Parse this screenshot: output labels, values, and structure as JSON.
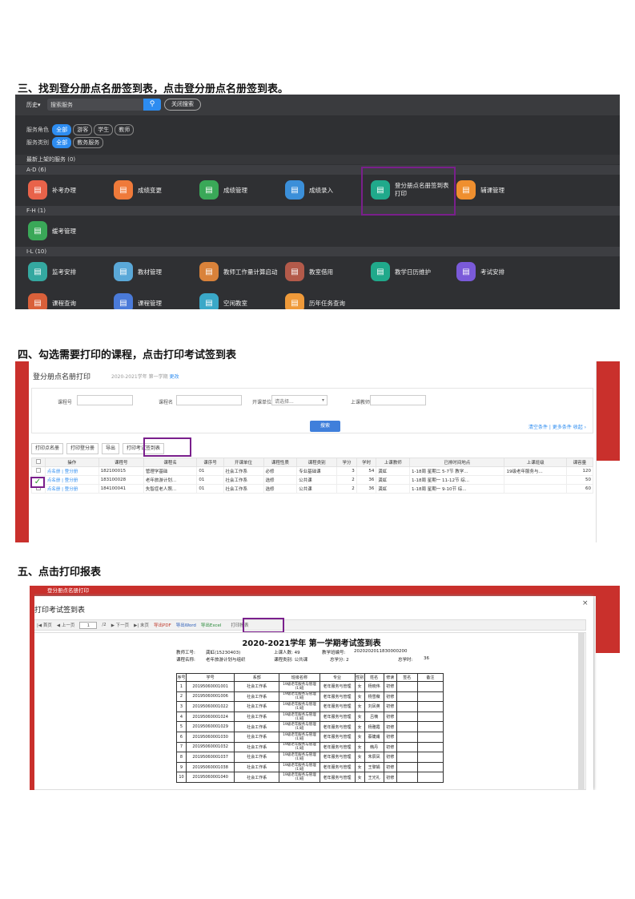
{
  "headings": {
    "h3": "三、找到登分册点名册签到表，点击登分册点名册签到表。",
    "h4": "四、勾选需要打印的课程，点击打印考试签到表",
    "h5": "五、点击打印报表"
  },
  "s3": {
    "history": "历史▾",
    "search_value": "搜索服务",
    "close_search": "关闭搜索",
    "role_label": "服务角色",
    "roles": [
      "全部",
      "游客",
      "学生",
      "教师"
    ],
    "type_label": "服务类别",
    "types": [
      "全部",
      "教务服务"
    ],
    "recent": "最新上架的服务 (0)",
    "group_ad": "A-D (6)",
    "group_fh": "F-H (1)",
    "group_il": "I-L (10)",
    "services_ad": [
      "补考办理",
      "成绩变更",
      "成绩管理",
      "成绩录入",
      "登分册点名册签到表打印",
      "辅课管理"
    ],
    "services_fh": [
      "缓考管理"
    ],
    "services_il": [
      "监考安排",
      "教材管理",
      "教师工作量计算启动",
      "教室借用",
      "教学日历维护",
      "考试安排",
      "课程查询",
      "课程管理",
      "空闲教室",
      "历年任务查询"
    ],
    "colors": {
      "accent": "#2d8cf0",
      "highlight": "#7a1f8c"
    }
  },
  "s4": {
    "title": "登分册点名册打印",
    "subtitle": "2020-2021学年 第一学期",
    "change": "更改",
    "form": {
      "course_no": "课程号",
      "course_name": "课程名",
      "dept": "开课单位",
      "dept_placeholder": "请选择...",
      "teacher": "上课教师",
      "query": "搜索",
      "links": "清空条件 | 更多条件  收起 ›"
    },
    "buttons": [
      "打印点名册",
      "打印登分册",
      "导出",
      "打印考试签到表"
    ],
    "columns": [
      "",
      "操作",
      "课程号",
      "课程名",
      "课序号",
      "开课单位",
      "课程性质",
      "课程类别",
      "学分",
      "学时",
      "上课教师",
      "已排时间地点",
      "上课班级",
      "课容量"
    ],
    "rows": [
      [
        "",
        "点名册 | 登分册",
        "182100015",
        "管理学基础",
        "01",
        "社会工作系",
        "必修",
        "专业基础课",
        "3",
        "54",
        "龚虹",
        "1-18周 星期二 5-7节 教学...",
        "19级老年服务与...",
        "120"
      ],
      [
        "",
        "点名册 | 登分册",
        "183100028",
        "老年旅游计划...",
        "01",
        "社会工作系",
        "选修",
        "公共课",
        "2",
        "36",
        "龚虹",
        "1-18周 星期一 11-12节 综...",
        "",
        "50"
      ],
      [
        "",
        "点名册 | 登分册",
        "184100041",
        "失智症老人照...",
        "01",
        "社会工作系",
        "选修",
        "公共课",
        "2",
        "36",
        "龚虹",
        "1-18周 星期一 9-10节 综...",
        "",
        "60"
      ]
    ]
  },
  "s5": {
    "window_title": "登分册点名册打印",
    "modal_title": "打印考试签到表",
    "toolbar": [
      "|◀ 首页",
      "◀ 上一页",
      "1",
      "/2",
      "▶ 下一页",
      "▶| 末页",
      "导出PDF",
      "导出Word",
      "导出Excel",
      "打印报表"
    ],
    "report_title": "2020-2021学年  第一学期考试签到表",
    "meta": {
      "teacher_no": "教师工号:",
      "teacher_val": "龚虹(15230403)",
      "count": "上课人数:  49",
      "task_no": "教学班编号:",
      "task_val": "2020202011830000200",
      "course_name": "课程名称:",
      "course_val": "老年旅游计划与组织",
      "category": "课程类别:  公共课",
      "credit": "总学分:  2",
      "hours": "总学时:",
      "hours_val": "36"
    },
    "columns": [
      "序号",
      "学号",
      "系部",
      "班级名称",
      "专业",
      "性别",
      "姓名",
      "修读",
      "签名",
      "备注"
    ],
    "rows": [
      [
        "1",
        "20195060001001",
        "社会工作系",
        "19级老年服务与管理(1)班",
        "老年服务与管理",
        "女",
        "杨晓伟",
        "初修",
        "",
        ""
      ],
      [
        "2",
        "20195060001006",
        "社会工作系",
        "19级老年服务与管理(1)班",
        "老年服务与管理",
        "女",
        "杨雪薇",
        "初修",
        "",
        ""
      ],
      [
        "3",
        "20195060001022",
        "社会工作系",
        "19级老年服务与管理(1)班",
        "老年服务与管理",
        "女",
        "刘凤英",
        "初修",
        "",
        ""
      ],
      [
        "4",
        "20195060001024",
        "社会工作系",
        "19级老年服务与管理(1)班",
        "老年服务与管理",
        "女",
        "吕楠",
        "初修",
        "",
        ""
      ],
      [
        "5",
        "20195060001029",
        "社会工作系",
        "19级老年服务与管理(1)班",
        "老年服务与管理",
        "女",
        "杨雅霞",
        "初修",
        "",
        ""
      ],
      [
        "6",
        "20195060001030",
        "社会工作系",
        "19级老年服务与管理(1)班",
        "老年服务与管理",
        "女",
        "蔡婕甫",
        "初修",
        "",
        ""
      ],
      [
        "7",
        "20195060001032",
        "社会工作系",
        "19级老年服务与管理(1)班",
        "老年服务与管理",
        "女",
        "韩丹",
        "初修",
        "",
        ""
      ],
      [
        "8",
        "20195060001037",
        "社会工作系",
        "19级老年服务与管理(1)班",
        "老年服务与管理",
        "女",
        "朱辰凤",
        "初修",
        "",
        ""
      ],
      [
        "9",
        "20195060001038",
        "社会工作系",
        "19级老年服务与管理(1)班",
        "老年服务与管理",
        "女",
        "王黎娟",
        "初修",
        "",
        ""
      ],
      [
        "10",
        "20195060001040",
        "社会工作系",
        "19级老年服务与管理(1)班",
        "老年服务与管理",
        "女",
        "王光礼",
        "初修",
        "",
        ""
      ]
    ]
  }
}
